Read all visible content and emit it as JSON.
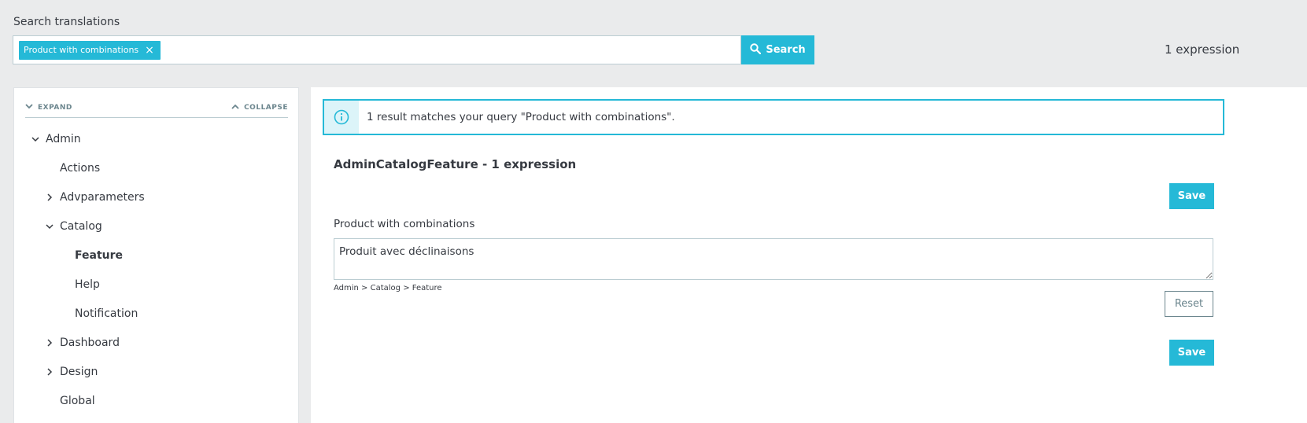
{
  "search": {
    "label": "Search translations",
    "tag": "Product with combinations",
    "tag_close": "×",
    "button_label": "Search"
  },
  "header": {
    "expression_count": "1 expression"
  },
  "sidebar": {
    "expand_label": "EXPAND",
    "collapse_label": "COLLAPSE",
    "items": [
      {
        "label": "Admin",
        "chevron": "down"
      },
      {
        "label": "Actions",
        "chevron": ""
      },
      {
        "label": "Advparameters",
        "chevron": "right"
      },
      {
        "label": "Catalog",
        "chevron": "down"
      },
      {
        "label": "Feature",
        "chevron": "",
        "active": true
      },
      {
        "label": "Help",
        "chevron": ""
      },
      {
        "label": "Notification",
        "chevron": ""
      },
      {
        "label": "Dashboard",
        "chevron": "right"
      },
      {
        "label": "Design",
        "chevron": "right"
      },
      {
        "label": "Global",
        "chevron": ""
      }
    ]
  },
  "main": {
    "alert_message": "1 result matches your query \"Product with combinations\".",
    "domain_title": "AdminCatalogFeature - 1 expression",
    "save_label": "Save",
    "field_label": "Product with combinations",
    "field_value": "Produit avec déclinaisons",
    "breadcrumb": "Admin > Catalog > Feature",
    "reset_label": "Reset"
  },
  "colors": {
    "accent": "#25b9d7",
    "background": "#eaebec",
    "text": "#363a41",
    "muted": "#6c868e",
    "border": "#bbcdd2"
  }
}
